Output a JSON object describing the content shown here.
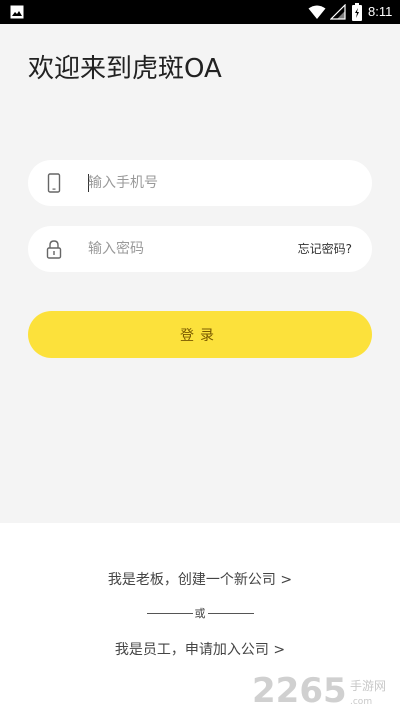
{
  "status_bar": {
    "time": "8:11",
    "icons": [
      "gallery-icon",
      "wifi-icon",
      "signal-icon",
      "battery-icon"
    ]
  },
  "welcome": {
    "title": "欢迎来到虎斑OA"
  },
  "phone": {
    "placeholder": "输入手机号",
    "icon": "phone-icon"
  },
  "password": {
    "placeholder": "输入密码",
    "icon": "lock-icon",
    "forgot_label": "忘记密码?"
  },
  "login": {
    "label": "登录"
  },
  "bottom": {
    "boss_link": "我是老板，创建一个新公司 >",
    "divider_text": "或",
    "employee_link": "我是员工，申请加入公司 >"
  },
  "watermark": {
    "text": "2265.com手游网"
  },
  "colors": {
    "accent": "#fce13b",
    "background": "#f4f4f4",
    "button_text": "#7a5a00"
  }
}
